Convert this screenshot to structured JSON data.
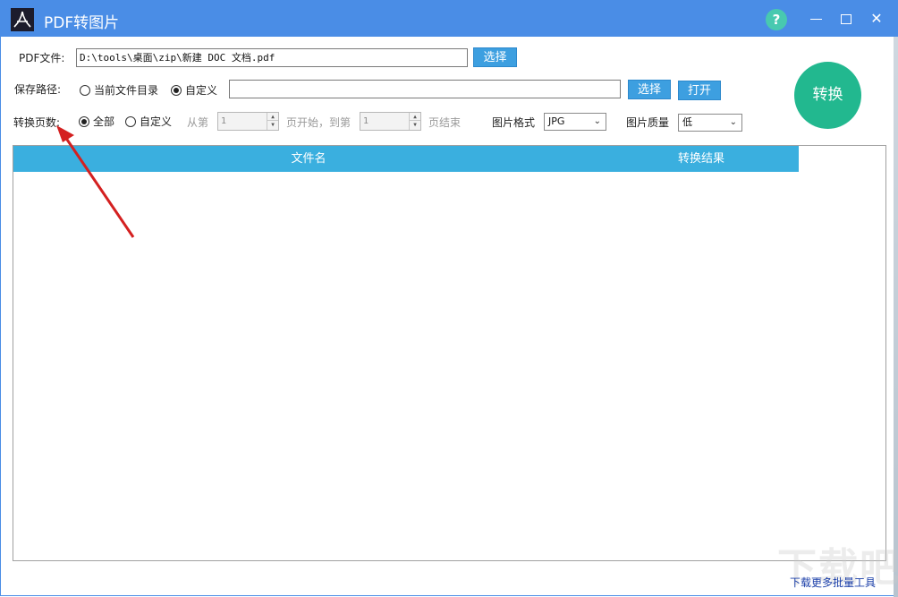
{
  "window": {
    "title": "PDF转图片",
    "help_label": "?"
  },
  "pdf_file": {
    "label": "PDF文件:",
    "value": "D:\\tools\\桌面\\zip\\新建 DOC 文档.pdf",
    "select_button": "选择"
  },
  "save_path": {
    "label": "保存路径:",
    "option_current": "当前文件目录",
    "option_custom": "自定义",
    "selected": "自定义",
    "value": "",
    "select_button": "选择",
    "open_button": "打开"
  },
  "page_range": {
    "label": "转换页数:",
    "option_all": "全部",
    "option_custom": "自定义",
    "selected": "全部",
    "from_label": "从第",
    "from_value": "1",
    "middle_label": "页开始，到第",
    "to_value": "1",
    "end_label": "页结束"
  },
  "image_format": {
    "label": "图片格式",
    "value": "JPG"
  },
  "image_quality": {
    "label": "图片质量",
    "value": "低"
  },
  "convert_button": "转换",
  "table": {
    "columns": [
      "文件名",
      "转换结果"
    ],
    "rows": []
  },
  "footer": {
    "link": "下载更多批量工具",
    "watermark": "下载吧"
  },
  "colors": {
    "titlebar": "#4a8de6",
    "button": "#3d9fe0",
    "convert": "#22b88f",
    "table_header": "#3aafdf",
    "arrow": "#d42020"
  }
}
